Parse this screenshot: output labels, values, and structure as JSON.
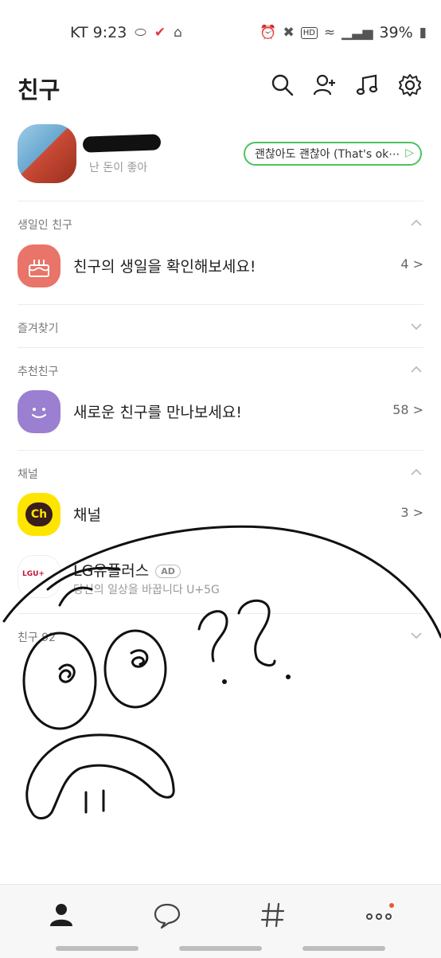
{
  "status_bar": {
    "carrier_time": "KT 9:23",
    "battery": "39%",
    "hd": "HD"
  },
  "header": {
    "title": "친구",
    "icons": [
      "search-icon",
      "add-friend-icon",
      "music-icon",
      "settings-icon"
    ]
  },
  "profile": {
    "status_message": "난 돈이 좋아",
    "music": "괜찮아도 괜찮아 (That's ok⋯"
  },
  "sections": {
    "birthday": {
      "label": "생일인 친구",
      "text": "친구의 생일을 확인해보세요!",
      "count": "4 >"
    },
    "favorites": {
      "label": "즐겨찾기"
    },
    "recommended": {
      "label": "추천친구",
      "text": "새로운 친구를 만나보세요!",
      "count": "58 >"
    },
    "channel": {
      "label": "채널",
      "channel_text": "채널",
      "channel_count": "3 >",
      "channel_logo": "Ch",
      "ad_name": "LG유플러스",
      "ad_badge": "AD",
      "ad_sub": "당신의 일상을 바꿉니다 U+5G",
      "ad_logo": "LGU+"
    },
    "friends": {
      "label": "친구 92"
    }
  },
  "tabbar": {
    "tabs": [
      "friends-tab-icon",
      "chats-tab-icon",
      "hashtag-tab-icon",
      "more-tab-icon"
    ]
  },
  "colors": {
    "accent_green": "#4cc35d",
    "birthday_icon": "#e8746a",
    "recommend_icon": "#9b7fd0",
    "channel_icon": "#fee500"
  }
}
